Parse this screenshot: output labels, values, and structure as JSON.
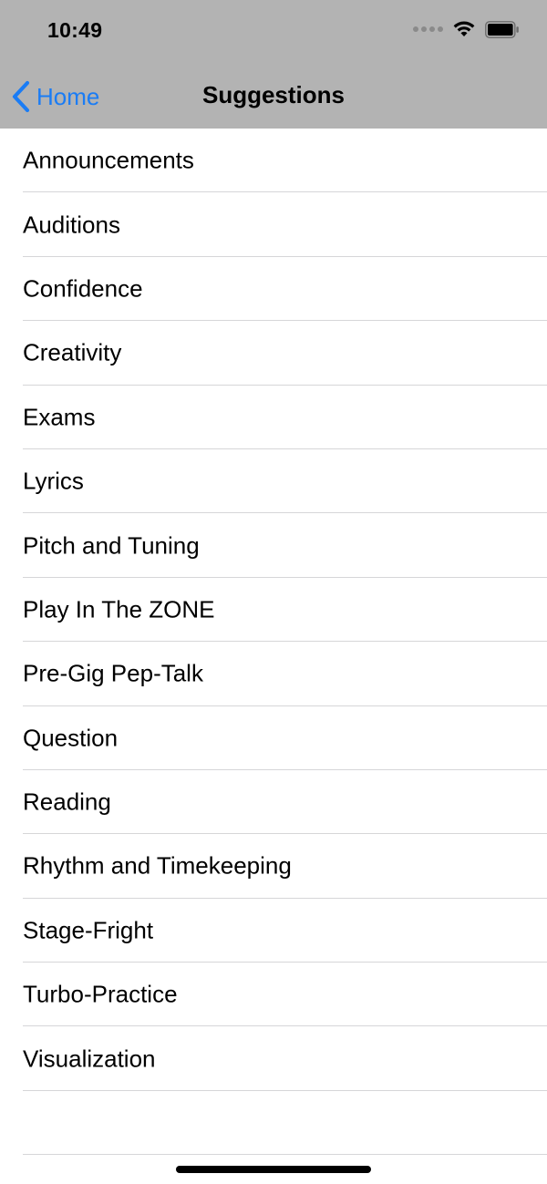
{
  "status_bar": {
    "time": "10:49",
    "icons": [
      "signal-dots-icon",
      "wifi-icon",
      "battery-icon"
    ]
  },
  "nav": {
    "back_label": "Home",
    "title": "Suggestions",
    "accent_color": "#1a7cf5",
    "header_color": "#b3b3b3"
  },
  "list": {
    "items": [
      {
        "label": "Announcements"
      },
      {
        "label": "Auditions"
      },
      {
        "label": "Confidence"
      },
      {
        "label": "Creativity"
      },
      {
        "label": "Exams"
      },
      {
        "label": "Lyrics"
      },
      {
        "label": "Pitch and Tuning"
      },
      {
        "label": "Play In The ZONE"
      },
      {
        "label": "Pre-Gig Pep-Talk"
      },
      {
        "label": "Question"
      },
      {
        "label": "Reading"
      },
      {
        "label": "Rhythm and Timekeeping"
      },
      {
        "label": "Stage-Fright"
      },
      {
        "label": "Turbo-Practice"
      },
      {
        "label": "Visualization"
      }
    ]
  }
}
